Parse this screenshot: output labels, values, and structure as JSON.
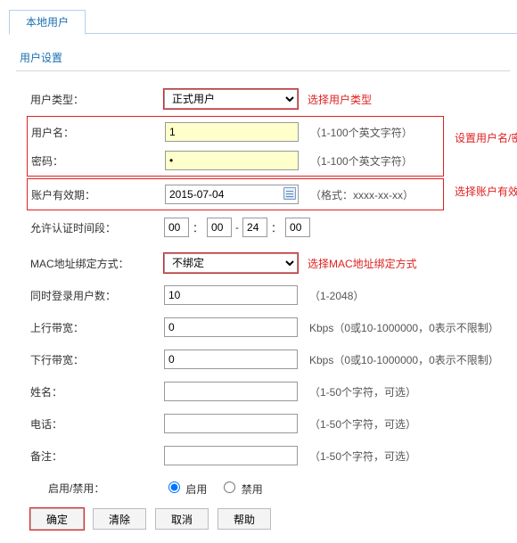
{
  "tab": {
    "label": "本地用户"
  },
  "section_title": "用户设置",
  "labels": {
    "user_type": "用户类型：",
    "username": "用户名：",
    "password": "密码：",
    "expiry": "账户有效期：",
    "auth_period": "允许认证时间段：",
    "mac_bind": "MAC地址绑定方式：",
    "concurrent": "同时登录用户数：",
    "up_bw": "上行带宽：",
    "down_bw": "下行带宽：",
    "name": "姓名：",
    "phone": "电话：",
    "remark": "备注：",
    "enable": "启用/禁用："
  },
  "values": {
    "user_type": "正式用户",
    "username": "1",
    "password": "•",
    "expiry": "2015-07-04",
    "time": {
      "h1": "00",
      "m1": "00",
      "h2": "24",
      "m2": "00"
    },
    "mac_bind": "不绑定",
    "concurrent": "10",
    "up_bw": "0",
    "down_bw": "0",
    "name": "",
    "phone": "",
    "remark": "",
    "enable": "on"
  },
  "hints": {
    "username": "（1-100个英文字符）",
    "password": "（1-100个英文字符）",
    "expiry": "（格式：xxxx-xx-xx）",
    "concurrent": "（1-2048）",
    "bw": "Kbps（0或10-1000000，0表示不限制）",
    "opt": "（1-50个字符，可选）"
  },
  "callouts": {
    "user_type": "选择用户类型",
    "credentials": "设置用户名/密码",
    "expiry": "选择账户有效期",
    "mac": "选择MAC地址绑定方式"
  },
  "radio": {
    "enable": "启用",
    "disable": "禁用"
  },
  "buttons": {
    "ok": "确定",
    "clear": "清除",
    "cancel": "取消",
    "help": "帮助"
  },
  "sep": {
    "colon": "：",
    "dash": "-"
  }
}
